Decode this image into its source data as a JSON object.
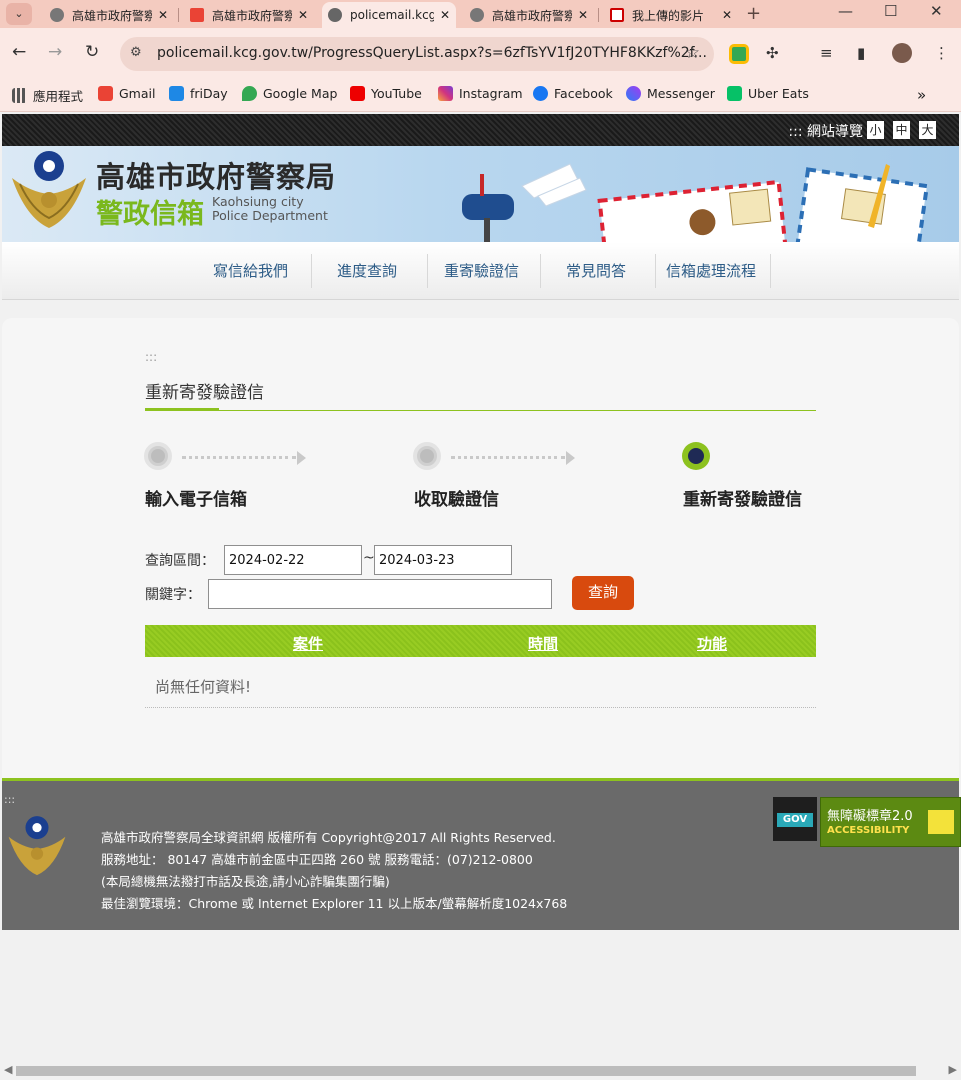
{
  "browser": {
    "tabs": [
      {
        "title": "高雄市政府警察",
        "favicon": "globe-icon",
        "active": false
      },
      {
        "title": "高雄市政府警察",
        "favicon": "gmail-icon",
        "active": false
      },
      {
        "title": "policemail.kcg",
        "favicon": "globe-icon",
        "active": true
      },
      {
        "title": "高雄市政府警察",
        "favicon": "globe-icon",
        "active": false
      },
      {
        "title": "我上傳的影片",
        "favicon": "studio-icon",
        "active": false
      }
    ],
    "url": "policemail.kcg.gov.tw/ProgressQueryList.aspx?s=6zfTsYV1fJ20TYHF8KKzf%2f...",
    "bookmarks": [
      "應用程式",
      "Gmail",
      "friDay",
      "Google Map",
      "YouTube",
      "Instagram",
      "Facebook",
      "Messenger",
      "Uber Eats"
    ],
    "colors": {
      "tab_strip": "#f4cbc0",
      "toolbar": "#fbe9e5"
    }
  },
  "site": {
    "guide": "::: 網站導覽",
    "font_sizes": [
      "小",
      "中",
      "大"
    ],
    "banner_title": "高雄市政府警察局",
    "banner_subtitle": "警政信箱",
    "banner_en1": "Kaohsiung city",
    "banner_en2": "Police Department",
    "nav": [
      "寫信給我們",
      "進度查詢",
      "重寄驗證信",
      "常見問答",
      "信箱處理流程"
    ],
    "colors": {
      "accent": "#8dc21f",
      "button": "#d84a0e",
      "nav_text": "#2d5c87"
    }
  },
  "main": {
    "access_key": ":::",
    "title": "重新寄發驗證信",
    "steps": [
      "輸入電子信箱",
      "收取驗證信",
      "重新寄發驗證信"
    ],
    "current_step": 3,
    "query_label": "查詢區間：",
    "date_from": "2024-02-22",
    "date_sep": "~",
    "date_to": "2024-03-23",
    "keyword_label": "關鍵字：",
    "keyword_value": "",
    "query_button": "查詢",
    "table_headers": [
      "案件",
      "時間",
      "功能"
    ],
    "empty_text": "尚無任何資料!"
  },
  "footer": {
    "access_key": ":::",
    "lines": [
      "高雄市政府警察局全球資訊網 版權所有 Copyright@2017 All Rights Reserved.",
      "服務地址： 80147 高雄市前金區中正四路 260 號 服務電話：(07)212-0800",
      "(本局總機無法撥打市話及長途,請小心詐騙集團行騙)",
      "最佳瀏覽環境：Chrome 或 Internet Explorer 11 以上版本/螢幕解析度1024x768"
    ],
    "gov_badge": "GOV",
    "a11y_badge": "無障礙標章2.0",
    "a11y_sub": "ACCESSIBILITY"
  }
}
